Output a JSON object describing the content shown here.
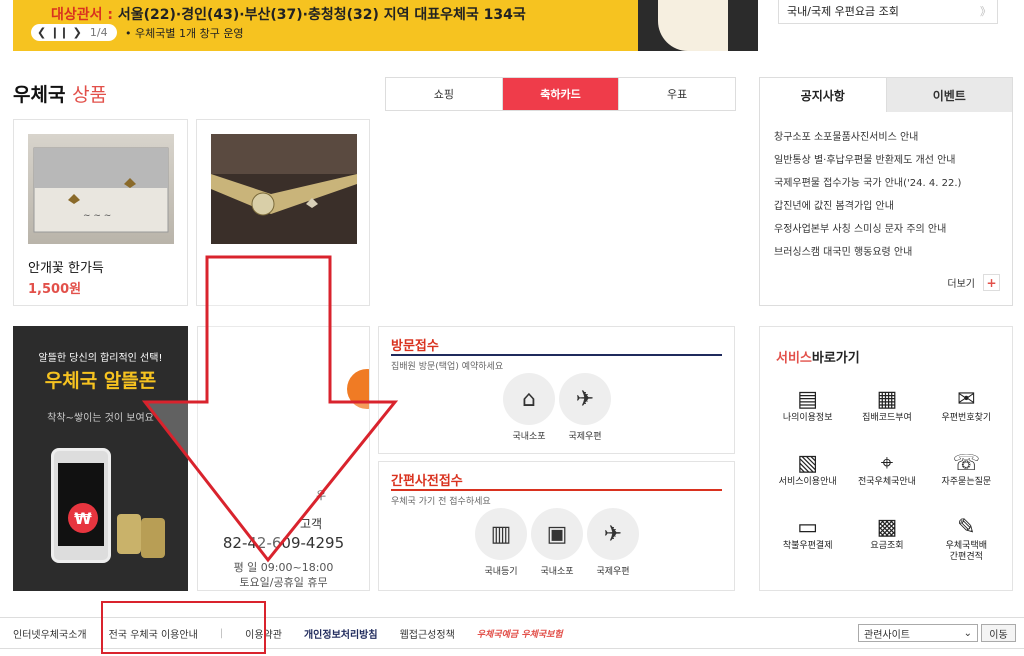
{
  "banner": {
    "tag": "대상관서 :",
    "headline": "서울(22)·경인(43)·부산(37)·충청청(32) 지역 대표우체국 134국",
    "pager_count": "1/4",
    "subline": "• 우체국별 1개 창구 운영"
  },
  "rate_lookup": {
    "label": "국내/국제 우편요금 조회",
    "arrow": "》"
  },
  "section": {
    "title_main": "우체국",
    "title_accent": "상품"
  },
  "tabs": [
    {
      "label": "쇼핑"
    },
    {
      "label": "축하카드"
    },
    {
      "label": "우표"
    }
  ],
  "products": [
    {
      "name": "안개꽃 한가득",
      "price": "1,500원"
    },
    {
      "name": "",
      "price": ""
    }
  ],
  "notice": {
    "tab_active": "공지사항",
    "tab_inactive": "이벤트",
    "items": [
      "창구소포 소포물품사진서비스 안내",
      "일반통상 별·후납우편물 반환제도 개선 안내",
      "국제우편물 접수가능 국가 안내('24. 4. 22.)",
      "갑진년에 값진 봄격가입 안내",
      "우정사업본부 사칭 스미싱 문자 주의 안내",
      "브러싱스캠 대국민 행동요령 안내"
    ],
    "more_label": "더보기",
    "more_icon": "+"
  },
  "promo": {
    "line1": "알뜰한 당신의 합리적인 선택!",
    "line2": "우체국 알뜰폰",
    "line3": "착착~쌓이는 것이 보여요",
    "won": "₩"
  },
  "center": {
    "mid": "우",
    "tel_label": "고객",
    "tel": "82-42-609-4295",
    "hours": "평 일   09:00~18:00",
    "holiday": "토요일/공휴일 휴무"
  },
  "visit": {
    "title": "방문접수",
    "desc": "집배원 방문(택업) 예약하세요",
    "items": [
      {
        "label": "국내소포",
        "icon": "house-truck-icon",
        "glyph": "⌂"
      },
      {
        "label": "국제우편",
        "icon": "plane-icon",
        "glyph": "✈"
      }
    ]
  },
  "simple": {
    "title": "간편사전접수",
    "desc": "우체국 가기 전 접수하세요",
    "items": [
      {
        "label": "국내등기",
        "icon": "barcode-icon",
        "glyph": "▥"
      },
      {
        "label": "국내소포",
        "icon": "box-icon",
        "glyph": "▣"
      },
      {
        "label": "국제우편",
        "icon": "plane-icon",
        "glyph": "✈"
      }
    ]
  },
  "quick": {
    "title_accent": "서비스",
    "title_rest": "바로가기",
    "items": [
      {
        "label": "나의이용정보",
        "glyph": "▤"
      },
      {
        "label": "집배코드부여",
        "glyph": "▦"
      },
      {
        "label": "우편번호찾기",
        "glyph": "✉"
      },
      {
        "label": "서비스이용안내",
        "glyph": "▧"
      },
      {
        "label": "전국우체국안내",
        "glyph": "⌖"
      },
      {
        "label": "자주묻는질문",
        "glyph": "☏"
      },
      {
        "label": "착불우편결제",
        "glyph": "▭"
      },
      {
        "label": "요금조회",
        "glyph": "▩"
      },
      {
        "label": "우체국택배\n간편견적",
        "glyph": "✎"
      }
    ]
  },
  "footer": {
    "links": [
      "인터넷우체국소개",
      "전국 우체국 이용안내",
      "이용약관",
      "개인정보처리방침",
      "웹접근성정책"
    ],
    "logo": "우체국예금 우체국보험",
    "select": "관련사이트",
    "go": "이동"
  },
  "colors": {
    "accent": "#ef3c4a",
    "banner": "#f6c320",
    "navy": "#1f2a5c"
  }
}
